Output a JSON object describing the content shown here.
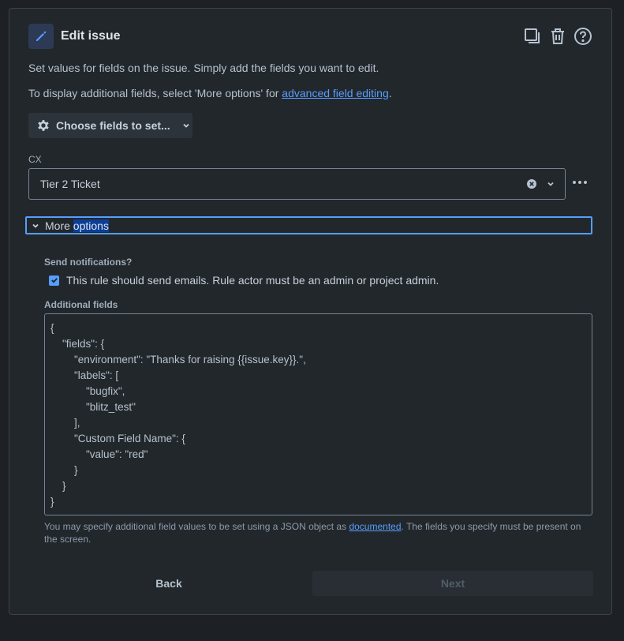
{
  "header": {
    "title": "Edit issue",
    "icons": [
      "edit-icon",
      "duplicate-icon",
      "trash-icon",
      "help-icon"
    ],
    "accent": "#579dff"
  },
  "description": {
    "line1": "Set values for fields on the issue. Simply add the fields you want to edit.",
    "line2_prefix": "To display additional fields, select 'More options' for ",
    "line2_link": "advanced field editing",
    "line2_suffix": "."
  },
  "choose_fields": {
    "label": "Choose fields to set..."
  },
  "cx_field": {
    "label": "CX",
    "value": "Tier 2 Ticket"
  },
  "more_options": {
    "label_plain": "More ",
    "label_highlighted": "options"
  },
  "notifications": {
    "label": "Send notifications?",
    "checkbox_label": "This rule should send emails. Rule actor must be an admin or project admin.",
    "checked": true
  },
  "additional_fields": {
    "label": "Additional fields",
    "json": "{\n    \"fields\": {\n        \"environment\": \"Thanks for raising {{issue.key}}.\",\n        \"labels\": [\n            \"bugfix\",\n            \"blitz_test\"\n        ],\n        \"Custom Field Name\": {\n            \"value\": \"red\"\n        }\n    }\n}",
    "help_prefix": "You may specify additional field values to be set using a JSON object as ",
    "help_link": "documented",
    "help_suffix": ". The fields you specify must be present on the screen."
  },
  "footer": {
    "back_label": "Back",
    "next_label": "Next"
  }
}
